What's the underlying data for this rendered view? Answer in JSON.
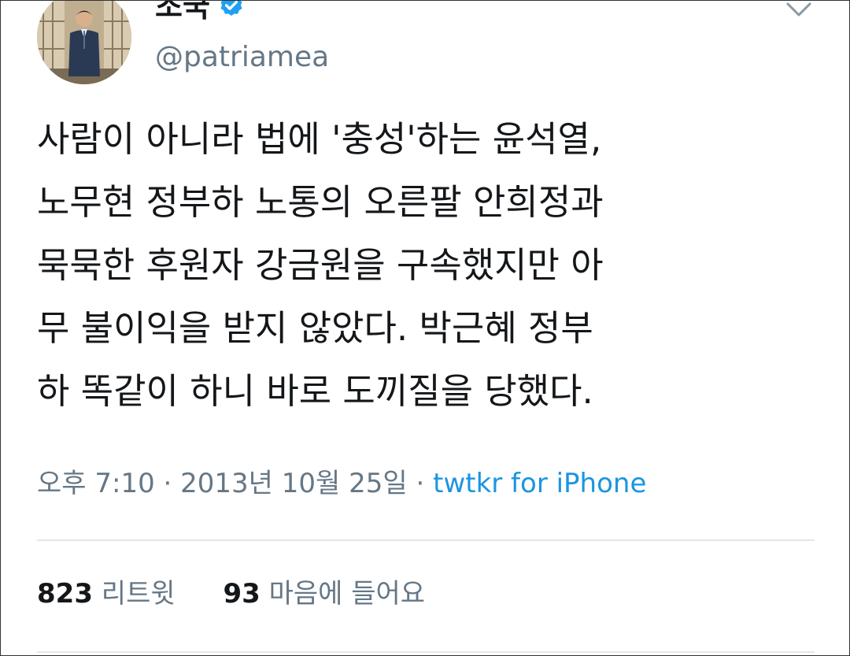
{
  "user": {
    "display_name": "조국",
    "handle": "@patriamea",
    "verified_icon": "verified-badge-icon",
    "avatar": "profile-photo",
    "menu_icon": "chevron-down-icon"
  },
  "tweet": {
    "text": "사람이 아니라 법에 '충성'하는 윤석열,\n노무현 정부하 노통의 오른팔 안희정과\n묵묵한 후원자 강금원을 구속했지만 아\n무 불이익을 받지 않았다. 박근혜 정부\n하 똑같이 하니 바로 도끼질을 당했다."
  },
  "meta": {
    "time": "오후 7:10",
    "separator1": " · ",
    "date": "2013년 10월 25일",
    "separator2": " · ",
    "source": "twtkr for iPhone"
  },
  "stats": {
    "retweets_count": "823",
    "retweets_label": "리트윗",
    "likes_count": "93",
    "likes_label": "마음에 들어요"
  },
  "colors": {
    "text": "#14171a",
    "secondary": "#657786",
    "link": "#1b95e0",
    "divider": "#e1e8ed",
    "verified": "#1da1f2"
  }
}
